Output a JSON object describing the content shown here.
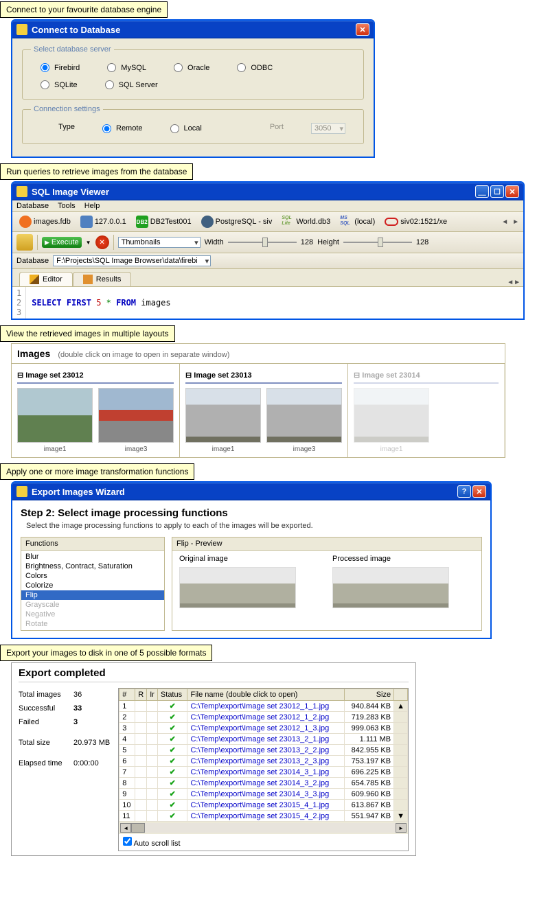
{
  "callouts": {
    "c1": "Connect to your favourite database engine",
    "c2": "Run queries to retrieve images from the database",
    "c3": "View the retrieved images in multiple layouts",
    "c4": "Apply one or more image transformation functions",
    "c5": "Export your images to disk in one of 5 possible formats"
  },
  "connect": {
    "title": "Connect to Database",
    "legend1": "Select database server",
    "opts": [
      "Firebird",
      "MySQL",
      "Oracle",
      "ODBC",
      "SQLite",
      "SQL Server"
    ],
    "legend2": "Connection settings",
    "type_lbl": "Type",
    "remote": "Remote",
    "local": "Local",
    "port_lbl": "Port",
    "port_val": "3050"
  },
  "viewer": {
    "title": "SQL Image Viewer",
    "menu": [
      "Database",
      "Tools",
      "Help"
    ],
    "conns": [
      {
        "name": "images.fdb",
        "color": "#F07020"
      },
      {
        "name": "127.0.0.1",
        "color": "#5080C0"
      },
      {
        "name": "DB2Test001",
        "color": "#20A020",
        "badge": "DB2"
      },
      {
        "name": "PostgreSQL - siv",
        "color": "#406080"
      },
      {
        "name": "World.db3",
        "color": "#70A040",
        "badge": "SQL\nLite"
      },
      {
        "name": "(local)",
        "color": "#4060C0",
        "badge": "MS\nSQL"
      },
      {
        "name": "siv02:1521/xe",
        "color": "#D02020"
      }
    ],
    "execute": "Execute",
    "view_mode": "Thumbnails",
    "width_lbl": "Width",
    "width_val": "128",
    "height_lbl": "Height",
    "height_val": "128",
    "db_lbl": "Database",
    "db_path": "F:\\Projects\\SQL Image Browser\\data\\firebi",
    "tab_editor": "Editor",
    "tab_results": "Results",
    "sql": {
      "l1": "SELECT",
      "l1b": "FIRST",
      "l1c": "5",
      "l1d": "*",
      "l1e": "FROM",
      "l1f": "images"
    }
  },
  "images": {
    "title": "Images",
    "hint": "(double click on image to open in separate window)",
    "sets": [
      {
        "name": "Image set 23012",
        "items": [
          "image1",
          "image3"
        ]
      },
      {
        "name": "Image set 23013",
        "items": [
          "image1",
          "image3"
        ]
      },
      {
        "name": "Image set 23014",
        "items": [
          "image1"
        ]
      }
    ]
  },
  "wizard": {
    "title": "Export Images Wizard",
    "step": "Step 2: Select image processing functions",
    "sub": "Select the image processing functions to apply to each of the images will be exported.",
    "fn_head": "Functions",
    "preview_head": "Flip - Preview",
    "orig": "Original image",
    "proc": "Processed image",
    "fns": [
      {
        "n": "Blur"
      },
      {
        "n": "Brightness, Contract, Saturation"
      },
      {
        "n": "Colors"
      },
      {
        "n": "Colorize"
      },
      {
        "n": "Flip",
        "sel": true
      },
      {
        "n": "Grayscale",
        "dis": true
      },
      {
        "n": "Negative",
        "dis": true
      },
      {
        "n": "Rotate",
        "dis": true
      }
    ]
  },
  "export": {
    "title": "Export completed",
    "total_lbl": "Total images",
    "total_val": "36",
    "succ_lbl": "Successful",
    "succ_val": "33",
    "fail_lbl": "Failed",
    "fail_val": "3",
    "size_lbl": "Total size",
    "size_val": "20.973 MB",
    "time_lbl": "Elapsed time",
    "time_val": "0:00:00",
    "cols": {
      "num": "#",
      "r": "R",
      "ir": "Ir",
      "status": "Status",
      "file": "File name (double click to open)",
      "size": "Size"
    },
    "rows": [
      {
        "n": "1",
        "f": "C:\\Temp\\export\\Image set 23012_1_1.jpg",
        "s": "940.844 KB"
      },
      {
        "n": "2",
        "f": "C:\\Temp\\export\\Image set 23012_1_2.jpg",
        "s": "719.283 KB"
      },
      {
        "n": "3",
        "f": "C:\\Temp\\export\\Image set 23012_1_3.jpg",
        "s": "999.063 KB"
      },
      {
        "n": "4",
        "f": "C:\\Temp\\export\\Image set 23013_2_1.jpg",
        "s": "1.111 MB"
      },
      {
        "n": "5",
        "f": "C:\\Temp\\export\\Image set 23013_2_2.jpg",
        "s": "842.955 KB"
      },
      {
        "n": "6",
        "f": "C:\\Temp\\export\\Image set 23013_2_3.jpg",
        "s": "753.197 KB"
      },
      {
        "n": "7",
        "f": "C:\\Temp\\export\\Image set 23014_3_1.jpg",
        "s": "696.225 KB"
      },
      {
        "n": "8",
        "f": "C:\\Temp\\export\\Image set 23014_3_2.jpg",
        "s": "654.785 KB"
      },
      {
        "n": "9",
        "f": "C:\\Temp\\export\\Image set 23014_3_3.jpg",
        "s": "609.960 KB"
      },
      {
        "n": "10",
        "f": "C:\\Temp\\export\\Image set 23015_4_1.jpg",
        "s": "613.867 KB"
      },
      {
        "n": "11",
        "f": "C:\\Temp\\export\\Image set 23015_4_2.jpg",
        "s": "551.947 KB"
      }
    ],
    "autoscroll": "Auto scroll list"
  }
}
